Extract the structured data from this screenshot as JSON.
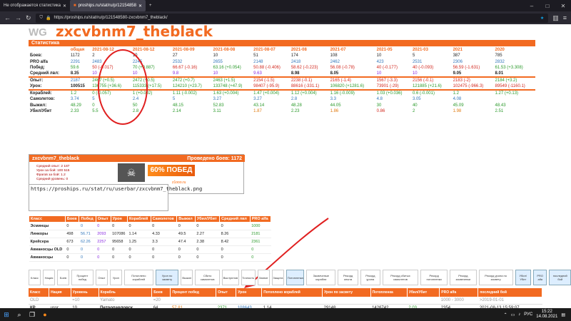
{
  "browser": {
    "tab1": "Не отображается статистика",
    "tab2": "proships.ru/stat/ru/p/12154858",
    "url": "https://proships.ru/stat/ru/p/121548580-zxcvbnm7_theblack/",
    "window_icons": [
      "minimize-icon",
      "maximize-icon",
      "close-icon"
    ]
  },
  "header": {
    "logo": "WG",
    "nick": "zxcvbnm7_theblack",
    "section": "Статистика"
  },
  "stats": {
    "columns": [
      "",
      "общая",
      "2021-08-12",
      "2021-08-12",
      "2021-08-09",
      "2021-08-08",
      "2021-08-07",
      "2021-08",
      "2021-07",
      "2021-05",
      "2021-03",
      "2021",
      "2020"
    ],
    "rows": [
      {
        "label": "Боев:",
        "cells": [
          "1172",
          "2",
          "10",
          "27",
          "10",
          "51",
          "174",
          "108",
          "10",
          "5",
          "387",
          "785"
        ]
      },
      {
        "label": "PRO alfa",
        "cells": [
          "2291",
          "2483",
          "2245",
          "2532",
          "2655",
          "2148",
          "2418",
          "2462",
          "423",
          "2531",
          "2306",
          "2832"
        ]
      },
      {
        "label": "Побед:",
        "cells": [
          "59.6",
          "50 (-0.017)",
          "70 (+0.887)",
          "66.67 (-0.16)",
          "63.16 (+0.054)",
          "50.88 (-0.406)",
          "58.62 (-0.223)",
          "56.08 (-0.78)",
          "40 (-0.177)",
          "40 (-0.093)",
          "56.59 (-1.631)",
          "61.53 (+3.308)"
        ]
      },
      {
        "label": "Средний лвл:",
        "cells": [
          "8.35",
          "10",
          "10",
          "9.8",
          "10",
          "9.63",
          "8.98",
          "8.05",
          "10",
          "10",
          "9.05",
          "8.01"
        ]
      },
      {
        "label": "Опыт:",
        "cells": [
          "2187",
          "2467 (+0.5)",
          "2472 (+0.5)",
          "2472 (+0.7)",
          "2463 (+1.5)",
          "2154 (-1.5)",
          "2238 (-0.1)",
          "2165 (-1.4)",
          "1567 (-3.3)",
          "2156 (-0.1)",
          "2183 (-2)",
          "2184 (+3.2)"
        ]
      },
      {
        "label": "Урон:",
        "cells": [
          "100515",
          "136755 (+36.6)",
          "115333 (+17.5)",
          "124210 (+23.7)",
          "133748 (+47.9)",
          "98407 (-95.9)",
          "88616 (-331.1)",
          "106820 (+1281.6)",
          "73901 (-29)",
          "121885 (+21.6)",
          "102475 (-966.3)",
          "89549 (-1160.1)"
        ]
      },
      {
        "label": "Кораблей:",
        "cells": [
          "1.2",
          "0 (-0.057)",
          "1 (+0.002)",
          "1.11 (-0.002)",
          "1.63 (+0.004)",
          "1.47 (+0.004)",
          "1.12 (+0.004)",
          "1.16 (-0.009)",
          "1.03 (+0.036)",
          "0.6 (-0.001)",
          "1.2",
          "1.27 (+0.13)"
        ]
      },
      {
        "label": "Самолетов:",
        "cells": [
          "3.74",
          "5",
          "2.4",
          "5",
          "3.27",
          "3.27",
          "2.8",
          "3.3",
          "4.8",
          "3.05",
          "4.08",
          ""
        ]
      },
      {
        "label": "Выжил:",
        "cells": [
          "48.29",
          "0",
          "50",
          "48.15",
          "52.83",
          "43.14",
          "48.28",
          "44.05",
          "30",
          "40",
          "45.09",
          "48.43"
        ]
      },
      {
        "label": "Убил/Убит",
        "cells": [
          "2.33",
          "5.5",
          "2.8",
          "2.14",
          "3.11",
          "1.87",
          "2.23",
          "1.86",
          "0.86",
          "2",
          "1.98",
          "2.51"
        ]
      }
    ]
  },
  "signature": {
    "nick": "zxcvbnm7_theblack",
    "battles": "Проведено боев: 1172",
    "rows": [
      [
        "Средний опыт:",
        "2 187"
      ],
      [
        "Урон за бой:",
        "100 515"
      ],
      [
        "Фрагов за бой:",
        "1.2"
      ],
      [
        "Средний уровень:",
        "0"
      ]
    ],
    "win": "60% ПОБЕД",
    "site": "z1ooo.ru"
  },
  "userbar_text": "https://proships.ru/stat/ru/userbar/zxcvbnm7_theblack.png",
  "class_table": {
    "headers": [
      "Класс",
      "Боев",
      "Побед",
      "Опыт",
      "Урон",
      "Кораблей",
      "Самолетов",
      "Выжил",
      "Убил/Убит",
      "Средний лвл",
      "PRO alfa"
    ],
    "rows": [
      [
        "Эсминцы",
        "0",
        "0",
        "0",
        "0",
        "0",
        "0",
        "0",
        "0",
        "0",
        "1000"
      ],
      [
        "Линкоры",
        "498",
        "56.71",
        "2093",
        "107086",
        "1.14",
        "4.33",
        "49.5",
        "2.27",
        "8.26",
        "2181"
      ],
      [
        "Крейсера",
        "673",
        "62.26",
        "2257",
        "95658",
        "1.25",
        "3.3",
        "47.4",
        "2.38",
        "8.42",
        "2361"
      ],
      [
        "Авианосцы OLD",
        "0",
        "0",
        "0",
        "0",
        "0",
        "0",
        "0",
        "0",
        "0",
        "0"
      ],
      [
        "Авианосцы",
        "0",
        "0",
        "0",
        "0",
        "0",
        "0",
        "0",
        "0",
        "0",
        "0"
      ]
    ]
  },
  "filters": [
    "Класс",
    "Нация",
    "Боев",
    "Процент побед",
    "Опыт",
    "Урон",
    "Потоплено кораблей",
    "Урон по засвету",
    "Выжил",
    "Сбито самолетов",
    "Выстрелов",
    "Точность",
    "Захват",
    "Защита",
    "Потопленка",
    "Засвеченые корабли",
    "Рекорд опыта",
    "Рекорд урона",
    "Рекорд сбитых самолетов",
    "Рекорд потопленки",
    "Рекорд засвеченки",
    "Рекорд урона по засвету",
    "Убил/Убит",
    "PRO alfa",
    "последний бой"
  ],
  "ships": {
    "headers": [
      "Класс",
      "Нация",
      "Уровень",
      "Корабль",
      "Боев",
      "Процент побед",
      "Опыт",
      "Урон",
      "Потоплено кораблей",
      "Урон по засвету",
      "Потопленка",
      "Убил/Убит",
      "PRO alfa",
      "последний бой"
    ],
    "filter_row": [
      "OLD",
      "",
      "=10",
      "Yamato",
      "=20",
      "",
      "",
      "",
      "",
      "",
      "",
      "",
      "1000 - 3000",
      ">2019-01-01"
    ],
    "rows": [
      [
        "КР",
        "ussr",
        "10",
        "Петропавловск",
        "64",
        "57.81",
        "2371",
        "108643",
        "1.14",
        "29148",
        "1426742",
        "2.03",
        "2354",
        "2021-08-13 15:59:07"
      ],
      [
        "ЛК",
        "uk",
        "10",
        "Conqueror",
        "64",
        "43.75",
        "2114",
        "140820",
        "1.08",
        "17706",
        "1573760",
        "1.82",
        "2451",
        "2021-08-09 21:20:26"
      ],
      [
        "КР",
        "uk",
        "10",
        "Minotaur",
        "38",
        "65.79",
        "2568",
        "117728",
        "1.37",
        "18184",
        "764195",
        "2.74",
        "2549",
        "2021-08-09 18:41:27"
      ]
    ]
  },
  "taskbar": {
    "lang": "РУС",
    "time": "15:22",
    "date": "14.08.2021"
  },
  "colors": {
    "accent": "#f26a21",
    "annotation": "#e02020"
  }
}
